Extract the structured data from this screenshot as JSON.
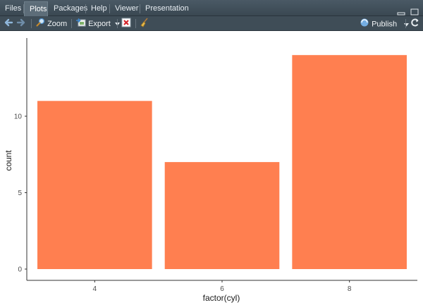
{
  "tabs": [
    {
      "label": "Files"
    },
    {
      "label": "Plots"
    },
    {
      "label": "Packages"
    },
    {
      "label": "Help"
    },
    {
      "label": "Viewer"
    },
    {
      "label": "Presentation"
    }
  ],
  "active_tab": "Plots",
  "toolbar": {
    "zoom_label": "Zoom",
    "export_label": "Export",
    "publish_label": "Publish"
  },
  "colors": {
    "bar_fill": "#ff7f50",
    "axis": "#333333",
    "tick_text": "#4d4d4d"
  },
  "chart_data": {
    "type": "bar",
    "categories": [
      "4",
      "6",
      "8"
    ],
    "values": [
      11,
      7,
      14
    ],
    "xlabel": "factor(cyl)",
    "ylabel": "count",
    "yticks": [
      0,
      5,
      10
    ],
    "ylim": [
      0,
      14.7
    ],
    "grid": false
  }
}
